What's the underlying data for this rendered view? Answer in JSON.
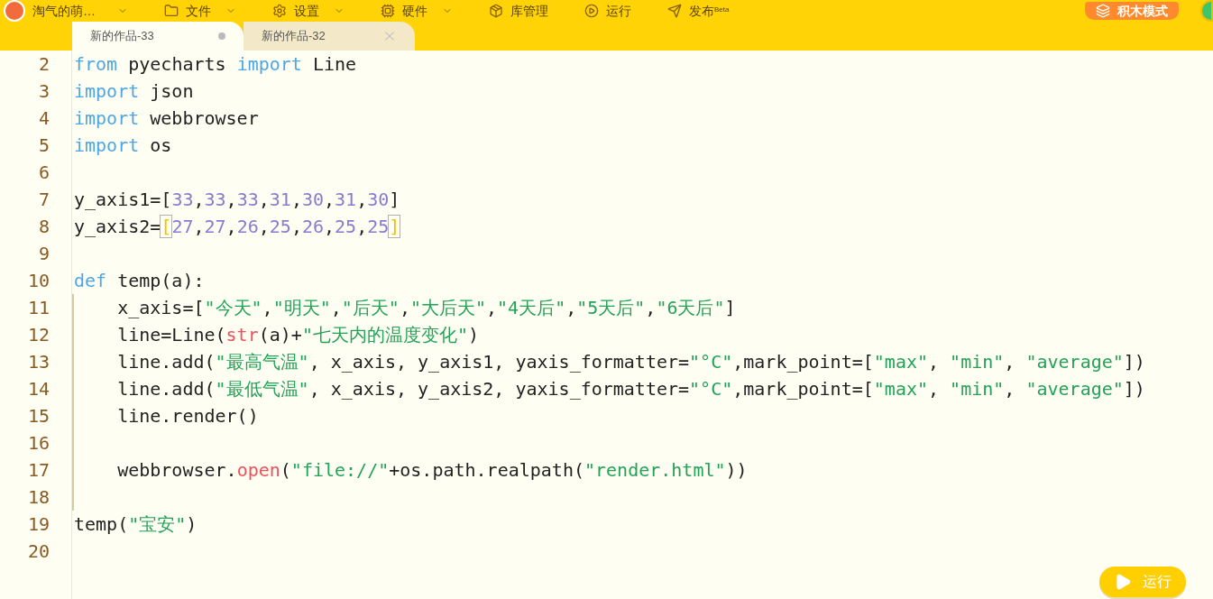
{
  "menu_bar": {
    "user": "淘气的萌…",
    "items": [
      {
        "label": "文件",
        "dropdown": true
      },
      {
        "label": "设置",
        "dropdown": true
      },
      {
        "label": "硬件",
        "dropdown": true
      },
      {
        "label": "库管理",
        "dropdown": false
      },
      {
        "label": "运行",
        "dropdown": false
      },
      {
        "label": "发布",
        "badge": "Beta",
        "dropdown": false
      }
    ],
    "mode_button": "积木模式"
  },
  "tabs": [
    {
      "label": "新的作品-33",
      "selected": true,
      "modified": true
    },
    {
      "label": "新的作品-32",
      "selected": false,
      "modified": false
    }
  ],
  "code_lines": [
    {
      "number": "2",
      "indented": false,
      "tokens": [
        {
          "kind": "keyword",
          "text": "from"
        },
        {
          "kind": "plain",
          "text": " pyecharts "
        },
        {
          "kind": "keyword",
          "text": "import"
        },
        {
          "kind": "plain",
          "text": " Line"
        }
      ]
    },
    {
      "number": "3",
      "indented": false,
      "tokens": [
        {
          "kind": "keyword",
          "text": "import"
        },
        {
          "kind": "plain",
          "text": " json"
        }
      ]
    },
    {
      "number": "4",
      "indented": false,
      "tokens": [
        {
          "kind": "keyword",
          "text": "import"
        },
        {
          "kind": "plain",
          "text": " webbrowser"
        }
      ]
    },
    {
      "number": "5",
      "indented": false,
      "tokens": [
        {
          "kind": "keyword",
          "text": "import"
        },
        {
          "kind": "plain",
          "text": " os"
        }
      ]
    },
    {
      "number": "6",
      "indented": false
    },
    {
      "number": "7",
      "indented": false,
      "tokens": [
        {
          "kind": "plain",
          "text": "y_axis1=["
        },
        {
          "kind": "number",
          "text": "33"
        },
        {
          "kind": "plain",
          "text": ","
        },
        {
          "kind": "number",
          "text": "33"
        },
        {
          "kind": "plain",
          "text": ","
        },
        {
          "kind": "number",
          "text": "33"
        },
        {
          "kind": "plain",
          "text": ","
        },
        {
          "kind": "number",
          "text": "31"
        },
        {
          "kind": "plain",
          "text": ","
        },
        {
          "kind": "number",
          "text": "30"
        },
        {
          "kind": "plain",
          "text": ","
        },
        {
          "kind": "number",
          "text": "31"
        },
        {
          "kind": "plain",
          "text": ","
        },
        {
          "kind": "number",
          "text": "30"
        },
        {
          "kind": "plain",
          "text": "]"
        }
      ]
    },
    {
      "number": "8",
      "indented": false,
      "tokens": [
        {
          "kind": "plain",
          "text": "y_axis2="
        },
        {
          "kind": "bracket",
          "text": "["
        },
        {
          "kind": "number",
          "text": "27"
        },
        {
          "kind": "plain",
          "text": ","
        },
        {
          "kind": "number",
          "text": "27"
        },
        {
          "kind": "plain",
          "text": ","
        },
        {
          "kind": "number",
          "text": "26"
        },
        {
          "kind": "plain",
          "text": ","
        },
        {
          "kind": "number",
          "text": "25"
        },
        {
          "kind": "plain",
          "text": ","
        },
        {
          "kind": "number",
          "text": "26"
        },
        {
          "kind": "plain",
          "text": ","
        },
        {
          "kind": "number",
          "text": "25"
        },
        {
          "kind": "plain",
          "text": ","
        },
        {
          "kind": "number",
          "text": "25"
        },
        {
          "kind": "bracket",
          "text": "]"
        }
      ]
    },
    {
      "number": "9",
      "indented": false
    },
    {
      "number": "10",
      "indented": false,
      "tokens": [
        {
          "kind": "keyword",
          "text": "def"
        },
        {
          "kind": "plain",
          "text": " temp(a):"
        }
      ]
    },
    {
      "number": "11",
      "indented": true,
      "tokens": [
        {
          "kind": "plain",
          "text": "    x_axis=["
        },
        {
          "kind": "string",
          "text": "\"今天\""
        },
        {
          "kind": "plain",
          "text": ","
        },
        {
          "kind": "string",
          "text": "\"明天\""
        },
        {
          "kind": "plain",
          "text": ","
        },
        {
          "kind": "string",
          "text": "\"后天\""
        },
        {
          "kind": "plain",
          "text": ","
        },
        {
          "kind": "string",
          "text": "\"大后天\""
        },
        {
          "kind": "plain",
          "text": ","
        },
        {
          "kind": "string",
          "text": "\"4天后\""
        },
        {
          "kind": "plain",
          "text": ","
        },
        {
          "kind": "string",
          "text": "\"5天后\""
        },
        {
          "kind": "plain",
          "text": ","
        },
        {
          "kind": "string",
          "text": "\"6天后\""
        },
        {
          "kind": "plain",
          "text": "]"
        }
      ]
    },
    {
      "number": "12",
      "indented": true,
      "tokens": [
        {
          "kind": "plain",
          "text": "    line=Line("
        },
        {
          "kind": "builtin",
          "text": "str"
        },
        {
          "kind": "plain",
          "text": "(a)+"
        },
        {
          "kind": "string",
          "text": "\"七天内的温度变化\""
        },
        {
          "kind": "plain",
          "text": ")"
        }
      ]
    },
    {
      "number": "13",
      "indented": true,
      "tokens": [
        {
          "kind": "plain",
          "text": "    line.add("
        },
        {
          "kind": "string",
          "text": "\"最高气温\""
        },
        {
          "kind": "plain",
          "text": ", x_axis, y_axis1, yaxis_formatter="
        },
        {
          "kind": "string",
          "text": "\"°C\""
        },
        {
          "kind": "plain",
          "text": ",mark_point=["
        },
        {
          "kind": "string",
          "text": "\"max\""
        },
        {
          "kind": "plain",
          "text": ", "
        },
        {
          "kind": "string",
          "text": "\"min\""
        },
        {
          "kind": "plain",
          "text": ", "
        },
        {
          "kind": "string",
          "text": "\"average\""
        },
        {
          "kind": "plain",
          "text": "])"
        }
      ]
    },
    {
      "number": "14",
      "indented": true,
      "tokens": [
        {
          "kind": "plain",
          "text": "    line.add("
        },
        {
          "kind": "string",
          "text": "\"最低气温\""
        },
        {
          "kind": "plain",
          "text": ", x_axis, y_axis2, yaxis_formatter="
        },
        {
          "kind": "string",
          "text": "\"°C\""
        },
        {
          "kind": "plain",
          "text": ",mark_point=["
        },
        {
          "kind": "string",
          "text": "\"max\""
        },
        {
          "kind": "plain",
          "text": ", "
        },
        {
          "kind": "string",
          "text": "\"min\""
        },
        {
          "kind": "plain",
          "text": ", "
        },
        {
          "kind": "string",
          "text": "\"average\""
        },
        {
          "kind": "plain",
          "text": "])"
        }
      ]
    },
    {
      "number": "15",
      "indented": true,
      "tokens": [
        {
          "kind": "plain",
          "text": "    line.render()"
        }
      ]
    },
    {
      "number": "16",
      "indented": true
    },
    {
      "number": "17",
      "indented": true,
      "tokens": [
        {
          "kind": "plain",
          "text": "    webbrowser."
        },
        {
          "kind": "builtin",
          "text": "open"
        },
        {
          "kind": "plain",
          "text": "("
        },
        {
          "kind": "string",
          "text": "\"file://\""
        },
        {
          "kind": "plain",
          "text": "+os.path.realpath("
        },
        {
          "kind": "string",
          "text": "\"render.html\""
        },
        {
          "kind": "plain",
          "text": "))"
        }
      ]
    },
    {
      "number": "18",
      "indented": true
    },
    {
      "number": "19",
      "indented": false,
      "tokens": [
        {
          "kind": "plain",
          "text": "temp("
        },
        {
          "kind": "string",
          "text": "\"宝安\""
        },
        {
          "kind": "plain",
          "text": ")"
        }
      ]
    },
    {
      "number": "20",
      "indented": false
    }
  ],
  "run_button": "运行"
}
